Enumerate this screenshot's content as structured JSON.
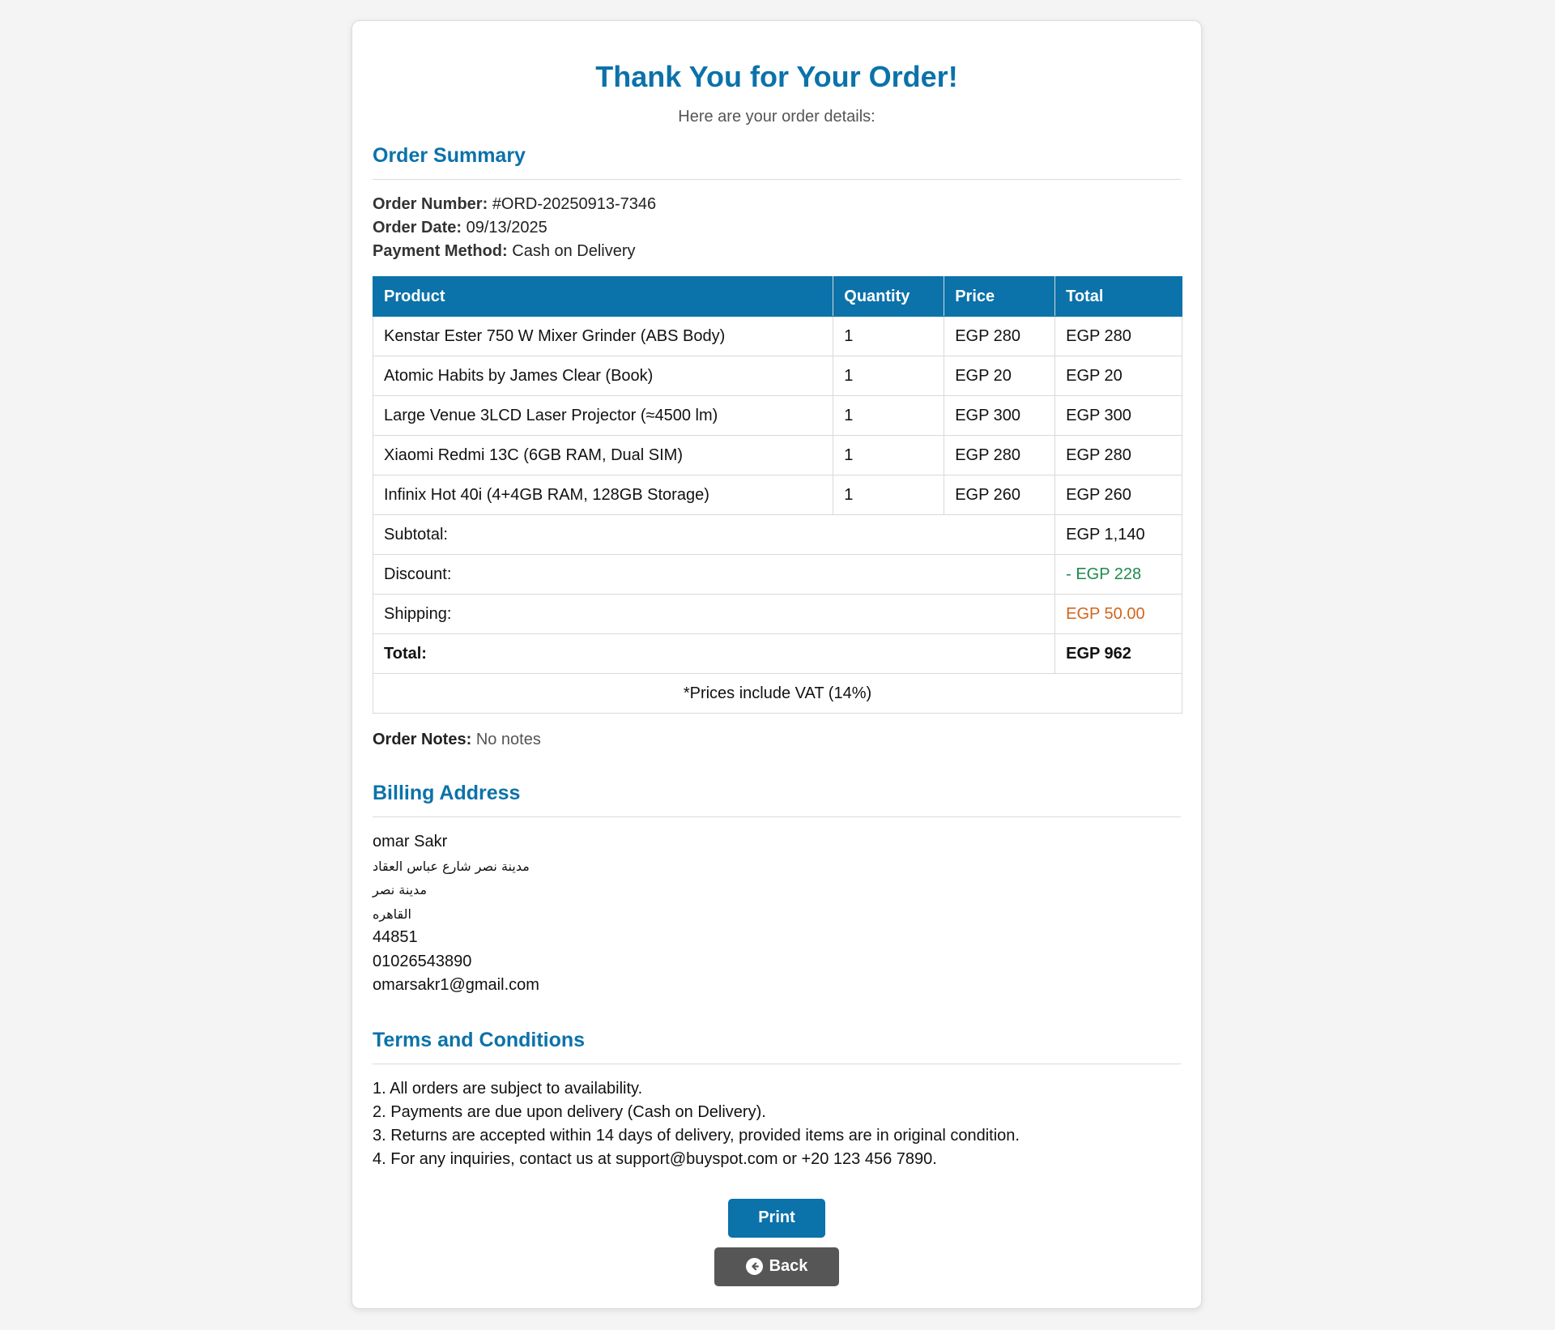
{
  "header": {
    "title": "Thank You for Your Order!",
    "subtitle": "Here are your order details:"
  },
  "summary": {
    "section_title": "Order Summary",
    "order_number_label": "Order Number:",
    "order_number": "#ORD-20250913-7346",
    "order_date_label": "Order Date:",
    "order_date": "09/13/2025",
    "payment_method_label": "Payment Method:",
    "payment_method": "Cash on Delivery"
  },
  "table": {
    "headers": [
      "Product",
      "Quantity",
      "Price",
      "Total"
    ],
    "rows": [
      {
        "product": "Kenstar Ester 750 W Mixer Grinder (ABS Body)",
        "quantity": "1",
        "price": "EGP 280",
        "total": "EGP 280"
      },
      {
        "product": "Atomic Habits by James Clear (Book)",
        "quantity": "1",
        "price": "EGP 20",
        "total": "EGP 20"
      },
      {
        "product": "Large Venue 3LCD Laser Projector (≈4500 lm)",
        "quantity": "1",
        "price": "EGP 300",
        "total": "EGP 300"
      },
      {
        "product": "Xiaomi Redmi 13C (6GB RAM, Dual SIM)",
        "quantity": "1",
        "price": "EGP 280",
        "total": "EGP 280"
      },
      {
        "product": "Infinix Hot 40i (4+4GB RAM, 128GB Storage)",
        "quantity": "1",
        "price": "EGP 260",
        "total": "EGP 260"
      }
    ],
    "subtotal_label": "Subtotal:",
    "subtotal": "EGP 1,140",
    "discount_label": "Discount:",
    "discount": "- EGP 228",
    "shipping_label": "Shipping:",
    "shipping": "EGP 50.00",
    "total_label": "Total:",
    "total": "EGP 962",
    "vat_note": "*Prices include VAT (14%)"
  },
  "notes": {
    "label": "Order Notes:",
    "value": "No notes"
  },
  "billing": {
    "section_title": "Billing Address",
    "name": "omar Sakr",
    "street": "مدينة نصر شارع عباس العقاد",
    "district": "مدينة نصر",
    "city": "القاهره",
    "postal_code": "44851",
    "phone": "01026543890",
    "email": "omarsakr1@gmail.com"
  },
  "terms": {
    "section_title": "Terms and Conditions",
    "items": [
      "1. All orders are subject to availability.",
      "2. Payments are due upon delivery (Cash on Delivery).",
      "3. Returns are accepted within 14 days of delivery, provided items are in original condition.",
      "4. For any inquiries, contact us at support@buyspot.com or +20 123 456 7890."
    ]
  },
  "buttons": {
    "print_label": "Print",
    "back_label": "Back",
    "back_icon": "arrow-left-circle-icon"
  },
  "colors": {
    "accent": "#0b72aa",
    "discount": "#1e8a4c",
    "shipping": "#d0661d",
    "back_button": "#565656",
    "background": "#f4f4f4"
  }
}
